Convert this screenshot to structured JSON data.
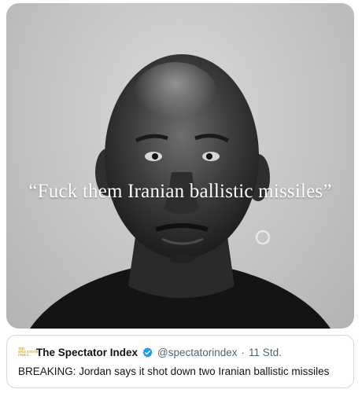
{
  "image": {
    "overlay_quote": "“Fuck them Iranian ballistic missiles”",
    "description_icon": "portrait-photo"
  },
  "quoted_tweet": {
    "logo_line1": "THE",
    "logo_line2": "SPECTATOR",
    "logo_line3": "INDEX",
    "display_name": "The Spectator Index",
    "verified_icon": "verified-badge-icon",
    "handle": "@spectatorindex",
    "separator": "·",
    "timestamp": "11 Std.",
    "text": "BREAKING: Jordan says it shot down two Iranian ballistic missiles"
  },
  "colors": {
    "verified": "#1d9bf0",
    "secondary_text": "#536471",
    "border": "#cfd9de"
  }
}
